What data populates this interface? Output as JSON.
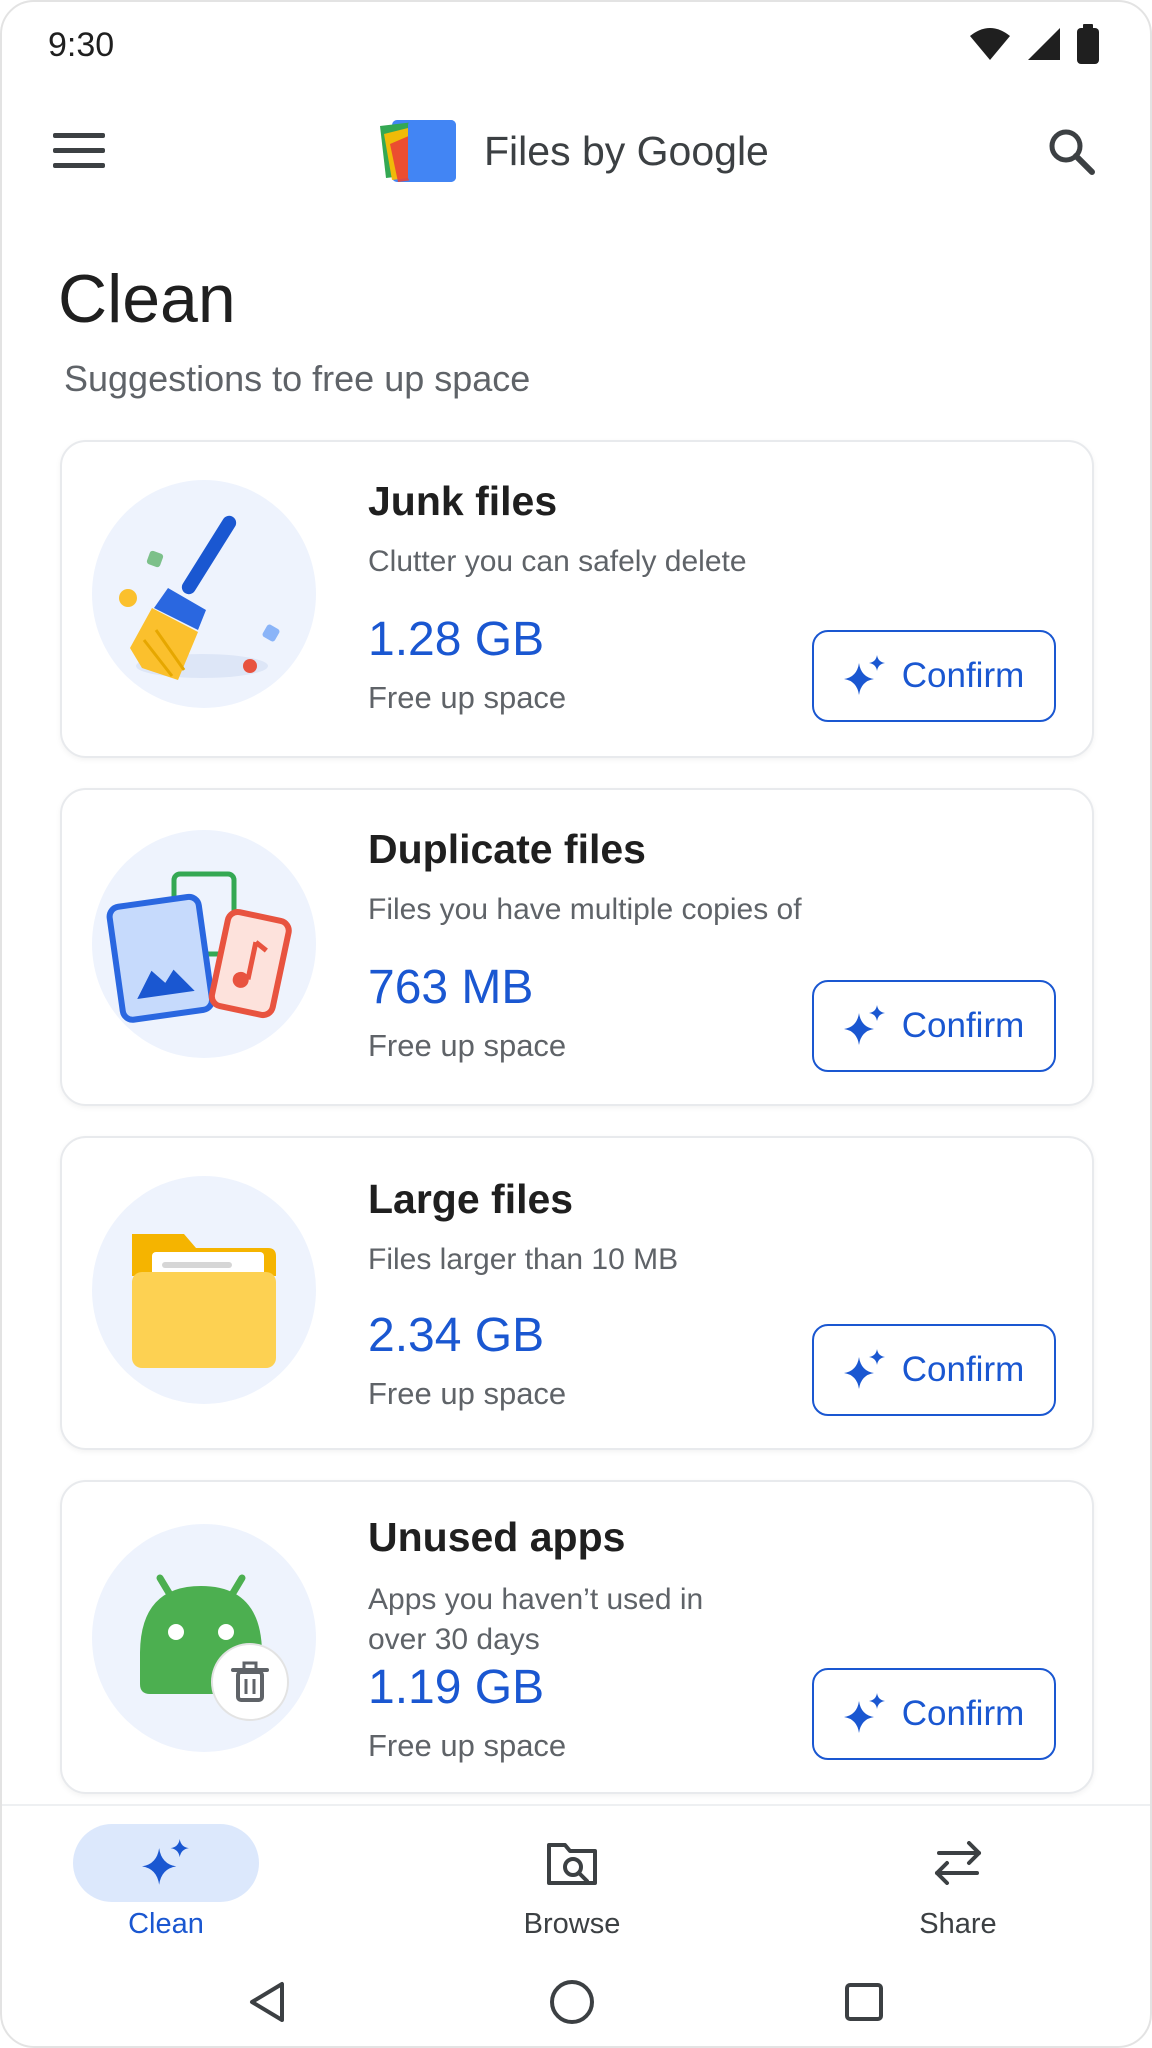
{
  "status_bar": {
    "time": "9:30"
  },
  "app_bar": {
    "title": "Files by Google"
  },
  "page": {
    "title": "Clean",
    "subtitle": "Suggestions to free up space"
  },
  "cards": [
    {
      "title": "Junk files",
      "description": "Clutter you can safely delete",
      "size": "1.28 GB",
      "subtitle": "Free up space",
      "button": "Confirm",
      "icon": "broom-icon"
    },
    {
      "title": "Duplicate files",
      "description": "Files you have multiple copies of",
      "size": "763 MB",
      "subtitle": "Free up space",
      "button": "Confirm",
      "icon": "duplicate-files-icon"
    },
    {
      "title": "Large files",
      "description": "Files larger than 10 MB",
      "size": "2.34 GB",
      "subtitle": "Free up space",
      "button": "Confirm",
      "icon": "folder-icon"
    },
    {
      "title": "Unused apps",
      "description": "Apps you haven’t used in over 30 days",
      "size": "1.19 GB",
      "subtitle": "Free up space",
      "button": "Confirm",
      "icon": "android-icon"
    }
  ],
  "bottom_nav": [
    {
      "label": "Clean",
      "icon": "sparkle-icon",
      "active": true
    },
    {
      "label": "Browse",
      "icon": "browse-folder-icon",
      "active": false
    },
    {
      "label": "Share",
      "icon": "swap-arrows-icon",
      "active": false
    }
  ],
  "colors": {
    "accent": "#1a57d1",
    "active_nav_bg": "#dce8fc",
    "illustration_bg": "#eef3fd"
  }
}
